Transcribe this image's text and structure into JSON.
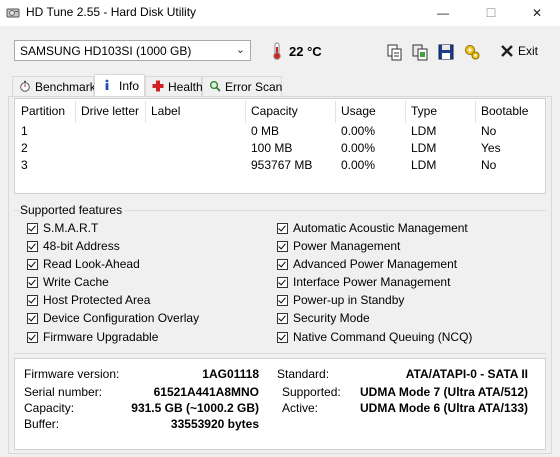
{
  "window": {
    "title": "HD Tune 2.55 - Hard Disk Utility",
    "minimize": "—",
    "maximize": "☐",
    "close": "✕"
  },
  "toolbar": {
    "drive": "SAMSUNG HD103SI (1000 GB)",
    "temperature": "22 °C",
    "exit_label": "Exit"
  },
  "tabs": [
    {
      "label": "Benchmark",
      "icon": "stopwatch-icon"
    },
    {
      "label": "Info",
      "icon": "info-icon"
    },
    {
      "label": "Health",
      "icon": "health-cross-icon"
    },
    {
      "label": "Error Scan",
      "icon": "magnifier-icon"
    }
  ],
  "partitions": {
    "headers": [
      "Partition",
      "Drive letter",
      "Label",
      "Capacity",
      "Usage",
      "Type",
      "Bootable"
    ],
    "rows": [
      [
        "1",
        "",
        "",
        "0 MB",
        "0.00%",
        "LDM",
        "No"
      ],
      [
        "2",
        "",
        "",
        "100 MB",
        "0.00%",
        "LDM",
        "Yes"
      ],
      [
        "3",
        "",
        "",
        "953767 MB",
        "0.00%",
        "LDM",
        "No"
      ]
    ]
  },
  "features": {
    "title": "Supported features",
    "left": [
      "S.M.A.R.T",
      "48-bit Address",
      "Read Look-Ahead",
      "Write Cache",
      "Host Protected Area",
      "Device Configuration Overlay",
      "Firmware Upgradable"
    ],
    "right": [
      "Automatic Acoustic Management",
      "Power Management",
      "Advanced Power Management",
      "Interface Power Management",
      "Power-up in Standby",
      "Security Mode",
      "Native Command Queuing (NCQ)"
    ]
  },
  "info": {
    "firmware_label": "Firmware version:",
    "firmware": "1AG01118",
    "serial_label": "Serial number:",
    "serial": "61521A441A8MNO",
    "capacity_label": "Capacity:",
    "capacity": "931.5 GB (~1000.2 GB)",
    "buffer_label": "Buffer:",
    "buffer": "33553920 bytes",
    "standard_label": "Standard:",
    "standard": "ATA/ATAPI-0 - SATA II",
    "supported_label": "Supported:",
    "supported": "UDMA Mode 7 (Ultra ATA/512)",
    "active_label": "Active:",
    "active": "UDMA Mode 6 (Ultra ATA/133)"
  }
}
